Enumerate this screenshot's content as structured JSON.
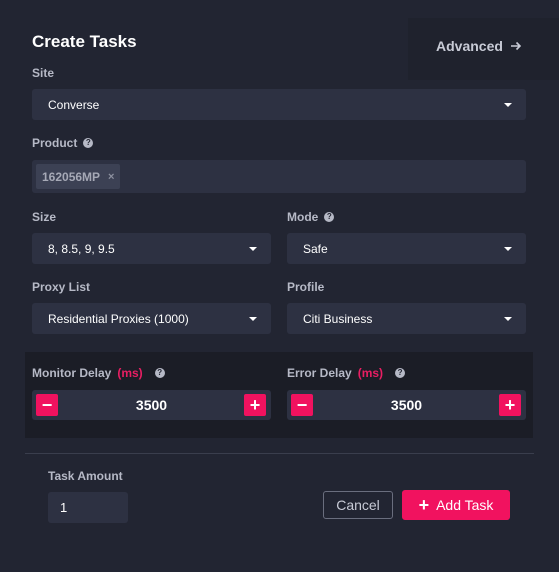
{
  "header": {
    "title": "Create Tasks",
    "advanced_label": "Advanced"
  },
  "fields": {
    "site": {
      "label": "Site",
      "value": "Converse"
    },
    "product": {
      "label": "Product",
      "help": "?",
      "tags": [
        "162056MP"
      ],
      "remove_glyph": "×"
    },
    "size": {
      "label": "Size",
      "value": "8, 8.5, 9, 9.5"
    },
    "mode": {
      "label": "Mode",
      "help": "?",
      "value": "Safe"
    },
    "proxy_list": {
      "label": "Proxy List",
      "value": "Residential Proxies (1000)"
    },
    "profile": {
      "label": "Profile",
      "value": "Citi Business"
    }
  },
  "delays": {
    "monitor": {
      "label": "Monitor Delay",
      "unit": "(ms)",
      "help": "?",
      "value": "3500"
    },
    "error": {
      "label": "Error Delay",
      "unit": "(ms)",
      "help": "?",
      "value": "3500"
    },
    "minus": "−",
    "plus": "+"
  },
  "footer": {
    "task_amount_label": "Task Amount",
    "task_amount_value": "1",
    "cancel_label": "Cancel",
    "add_task_label": "Add Task",
    "add_task_icon": "+"
  },
  "colors": {
    "accent": "#f1125f",
    "background": "#222532",
    "field": "#2d3142"
  }
}
